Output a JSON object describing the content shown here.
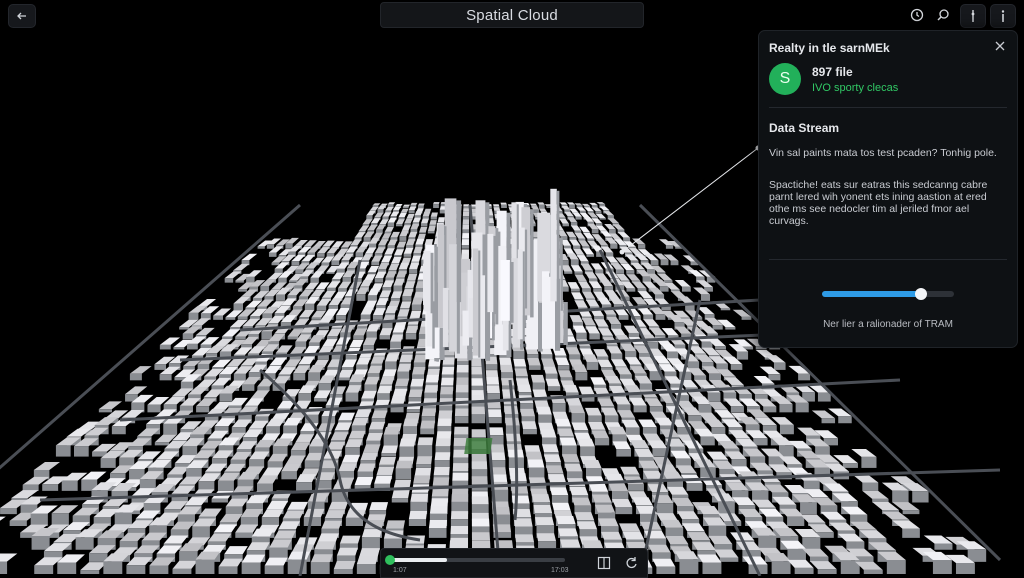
{
  "app": {
    "title": "Spatial Cloud"
  },
  "toolbar": {
    "back_icon": "arrow-left-icon",
    "right_icons": [
      "clock-icon",
      "search-icon",
      "pin-icon",
      "info-icon"
    ]
  },
  "panel": {
    "header": "Realty in tle sarnMEk",
    "close_icon": "close-icon",
    "avatar_letter": "S",
    "file_count": "897 file",
    "file_status": "IVO sporty clecas",
    "section_title": "Data Stream",
    "para1": "Vin sal paints mata tos test pcaden? Tonhig pole.",
    "para2": "Spactiche! eats sur eatras this sedcanng cabre parnt lered wih yonent ets ining aastion at ered othe ms see nedocler tim al jeriled fmor ael curvags.",
    "slider": {
      "value": 0.75
    },
    "caption": "Ner lier a ralionader of TRAM"
  },
  "playback": {
    "progress": 0.33,
    "time_left": "1:07",
    "time_right": "17:03",
    "icons": [
      "columns-icon",
      "rotate-icon"
    ]
  },
  "colors": {
    "accent_green": "#22b05a",
    "accent_blue": "#2e9be6",
    "background": "#000000"
  }
}
